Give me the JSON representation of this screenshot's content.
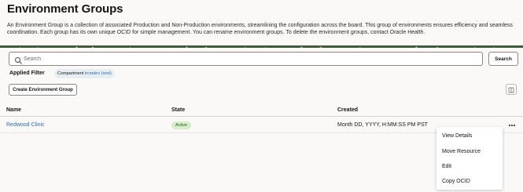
{
  "page": {
    "title": "Environment Groups",
    "description": "An Environment Group is a collection of associated Production and Non-Production environments, streamlining the configuration across the board. This group of environments ensures efficiency and seamless coordination. Each group has its own unique OCID for simple management. You can rename environment groups. To delete the environment groups, contact Oracle Health."
  },
  "search": {
    "placeholder": "Search",
    "value": "",
    "button_label": "Search"
  },
  "filter": {
    "label": "Applied Filter",
    "chip_key": "Compartment",
    "chip_value": "ircmdev (root)"
  },
  "toolbar": {
    "create_label": "Create Environment Group"
  },
  "table": {
    "columns": [
      "Name",
      "State",
      "Created"
    ],
    "rows": [
      {
        "name": "Redwood Clinic",
        "state": "Active",
        "created": "Month DD, YYYY, H:MM:SS PM PST"
      }
    ]
  },
  "row_menu": {
    "items": [
      "View Details",
      "Move Resource",
      "Edit",
      "Copy OCID"
    ]
  },
  "colors": {
    "link": "#2b6cb0",
    "active_badge_bg": "#d5edc8",
    "active_badge_text": "#2d5c1b",
    "chip_bg": "#e6eef2"
  },
  "icons": {
    "search": "search-icon",
    "columns": "columns-icon",
    "row_actions": "more-horizontal-icon"
  }
}
